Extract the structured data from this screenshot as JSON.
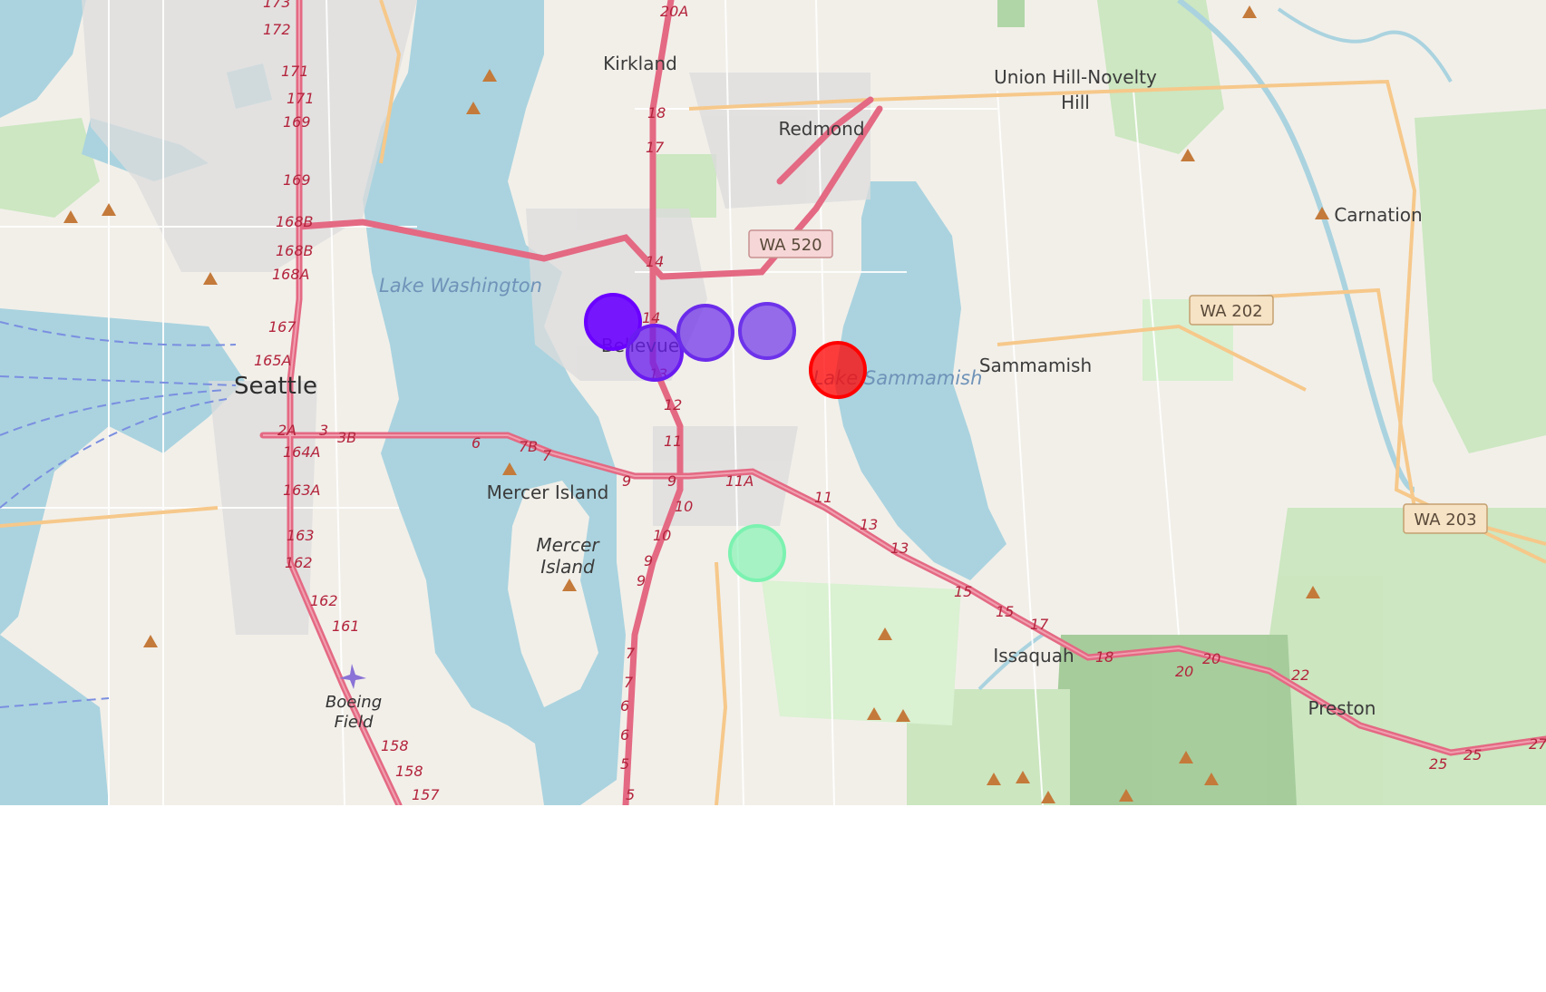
{
  "map": {
    "places": {
      "kirkland": "Kirkland",
      "redmond": "Redmond",
      "union_hill": "Union Hill-Novelty",
      "union_hill_2": "Hill",
      "carnation": "Carnation",
      "sammamish": "Sammamish",
      "seattle": "Seattle",
      "bellevue": "Bellevue",
      "mercer_island": "Mercer Island",
      "mercer_island_area_1": "Mercer",
      "mercer_island_area_2": "Island",
      "issaquah": "Issaquah",
      "preston": "Preston",
      "boeing_1": "Boeing",
      "boeing_2": "Field"
    },
    "water": {
      "lake_washington": "Lake Washington",
      "lake_sammamish": "Lake Sammamish"
    },
    "shields": {
      "wa520": "WA 520",
      "wa202": "WA 202",
      "wa203": "WA 203"
    },
    "exits": {
      "e173": "173",
      "e172": "172",
      "e171a": "171",
      "e171b": "171",
      "e169a": "169",
      "e169b": "169",
      "e168b1": "168B",
      "e168b2": "168B",
      "e168a": "168A",
      "e167": "167",
      "e165a": "165A",
      "e2a": "2A",
      "e3": "3",
      "e3b": "3B",
      "e164a": "164A",
      "e163a": "163A",
      "e163": "163",
      "e162a": "162",
      "e162b": "162",
      "e161": "161",
      "e158a": "158",
      "e158b": "158",
      "e157": "157",
      "e20a": "20A",
      "e18": "18",
      "e17": "17",
      "e14a": "14",
      "e14b": "14",
      "e13": "13",
      "e12": "12",
      "e11": "11",
      "e11a": "11A",
      "e11b": "11",
      "e13b": "13",
      "e13c": "13",
      "e10a": "10",
      "e10b": "10",
      "e9a": "9",
      "e9b": "9",
      "e9c": "9",
      "e9d": "9",
      "e7b": "7B",
      "e7": "7",
      "e6": "6",
      "e7c": "7",
      "e7d": "7",
      "e6a": "6",
      "e6b": "6",
      "e5a": "5",
      "e5b": "5",
      "e15a": "15",
      "e15b": "15",
      "e17b": "17",
      "e18b": "18",
      "e20b": "20",
      "e20c": "20",
      "e22": "22",
      "e25a": "25",
      "e25b": "25",
      "e27": "27"
    },
    "markers": [
      {
        "name": "marker-1",
        "color": "#6a00ff",
        "opacity": 0.9
      },
      {
        "name": "marker-2",
        "color": "#6a1bf0",
        "opacity": 0.75
      },
      {
        "name": "marker-3",
        "color": "#6b2bea",
        "opacity": 0.7
      },
      {
        "name": "marker-4",
        "color": "#6d33ea",
        "opacity": 0.7
      },
      {
        "name": "marker-5",
        "color": "#ff0000",
        "opacity": 0.75
      },
      {
        "name": "marker-6",
        "color": "#7cf2b0",
        "opacity": 0.65
      }
    ]
  }
}
